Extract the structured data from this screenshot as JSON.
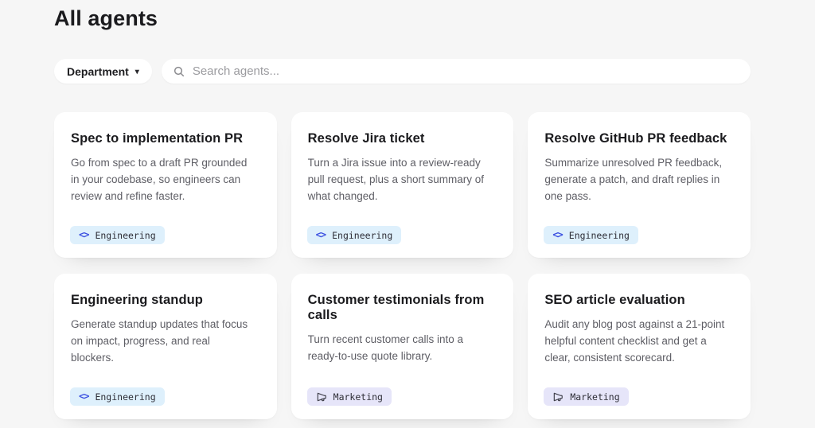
{
  "page": {
    "title": "All agents"
  },
  "filters": {
    "department_label": "Department",
    "caret_glyph": "▾",
    "search_placeholder": "Search agents..."
  },
  "icons": {
    "code_glyph": "<>",
    "search_icon": "magnifier",
    "megaphone_icon": "megaphone"
  },
  "colors": {
    "page_background": "#f6f6f6",
    "card_background": "#ffffff",
    "engineering_tag_bg": "#def0fc",
    "engineering_icon": "#3b4fe0",
    "marketing_tag_bg": "#e6e5f9",
    "marketing_icon": "#3f3f4a"
  },
  "cards": [
    {
      "title": "Spec to implementation PR",
      "description": "Go from spec to a draft PR grounded in your codebase, so engineers can review and refine faster.",
      "tag": "Engineering",
      "tag_type": "engineering"
    },
    {
      "title": "Resolve Jira ticket",
      "description": "Turn a Jira issue into a review-ready pull request, plus a short summary of what changed.",
      "tag": "Engineering",
      "tag_type": "engineering"
    },
    {
      "title": "Resolve GitHub PR feedback",
      "description": "Summarize unresolved PR feedback, generate a patch, and draft replies in one pass.",
      "tag": "Engineering",
      "tag_type": "engineering"
    },
    {
      "title": "Engineering standup",
      "description": "Generate standup updates that focus on impact, progress, and real blockers.",
      "tag": "Engineering",
      "tag_type": "engineering"
    },
    {
      "title": "Customer testimonials from calls",
      "description": "Turn recent customer calls into a ready-to-use quote library.",
      "tag": "Marketing",
      "tag_type": "marketing"
    },
    {
      "title": "SEO article evaluation",
      "description": "Audit any blog post against a 21-point helpful content checklist and get a clear, consistent scorecard.",
      "tag": "Marketing",
      "tag_type": "marketing"
    }
  ]
}
